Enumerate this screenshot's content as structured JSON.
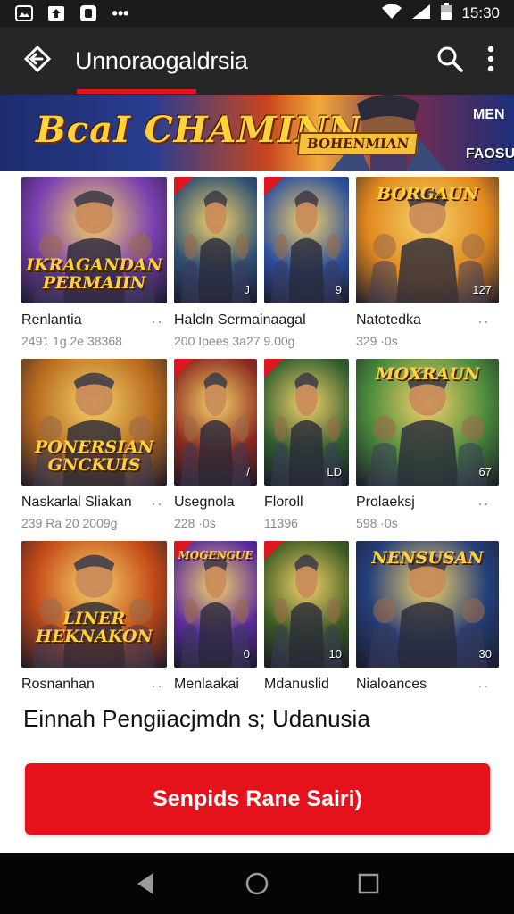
{
  "status_bar": {
    "time": "15:30",
    "left_icons": [
      "gallery-icon",
      "upload-icon",
      "app-icon",
      "more-notifications-icon"
    ],
    "right_icons": [
      "wifi-icon",
      "signal-icon",
      "battery-icon"
    ]
  },
  "app_bar": {
    "title": "Unnoraogaldrsia",
    "back_icon": "back-diamond-icon",
    "search_icon": "search-icon",
    "menu_icon": "overflow-menu-icon"
  },
  "banner": {
    "title": "BcaI CHAMINN",
    "badge": "BOHENMIAN",
    "right_top": "MEN",
    "right_bottom": "FAOSU"
  },
  "games": [
    {
      "title": "Renlantia",
      "meta": "2491 1g 2e 38368",
      "thumb_text": "IKRAGANDAN PERMAIIN",
      "count": "",
      "accent": "#7a3fb0"
    },
    {
      "title": "Halcln Sermainaagal",
      "meta": "200 Ipees 3a27 9.00g",
      "thumb_text": "",
      "count": "J",
      "accent": "#2d4f73"
    },
    {
      "title": "",
      "meta": "",
      "thumb_text": "",
      "count": "9",
      "accent": "#2a4f9c"
    },
    {
      "title": "Natotedka",
      "meta": "329 ·0s",
      "thumb_text": "BORGAUN",
      "count": "127",
      "accent": "#e28a1e"
    },
    {
      "title": "Naskarlal Sliakan",
      "meta": "239 Ra 20 2009g",
      "thumb_text": "PONERSIAN GNCKUIS",
      "count": "",
      "accent": "#b86a1e"
    },
    {
      "title": "Usegnola",
      "meta": "228 ·0s",
      "thumb_text": "",
      "count": "/",
      "accent": "#8a2a1e"
    },
    {
      "title": "Floroll",
      "meta": "11396",
      "thumb_text": "",
      "count": "LD",
      "accent": "#2f5d2e"
    },
    {
      "title": "Prolaeksj",
      "meta": "598 ·0s",
      "thumb_text": "MOXRAUN",
      "count": "67",
      "accent": "#4a8a3a"
    },
    {
      "title": "Rosnanhan",
      "meta": "",
      "thumb_text": "LINER HEKNAKON",
      "count": "",
      "accent": "#c44a18"
    },
    {
      "title": "Menlaakai",
      "meta": "",
      "thumb_text": "MOGENGUE",
      "count": "0",
      "accent": "#5a2a9c"
    },
    {
      "title": "Mdanuslid",
      "meta": "",
      "thumb_text": "",
      "count": "10",
      "accent": "#3a5a22"
    },
    {
      "title": "Nialoances",
      "meta": "",
      "thumb_text": "NENSUSAN",
      "count": "30",
      "accent": "#243f7a"
    }
  ],
  "headline": "Einnah Pengiiacjmdn s; Udanusia",
  "cta_label": "Senpids Rane Sairi)",
  "nav": {
    "back": "nav-back-icon",
    "home": "nav-home-icon",
    "recents": "nav-recents-icon"
  },
  "colors": {
    "accent_red": "#e5121c",
    "app_bar": "#262626",
    "status_bar": "#1b1b1b"
  }
}
